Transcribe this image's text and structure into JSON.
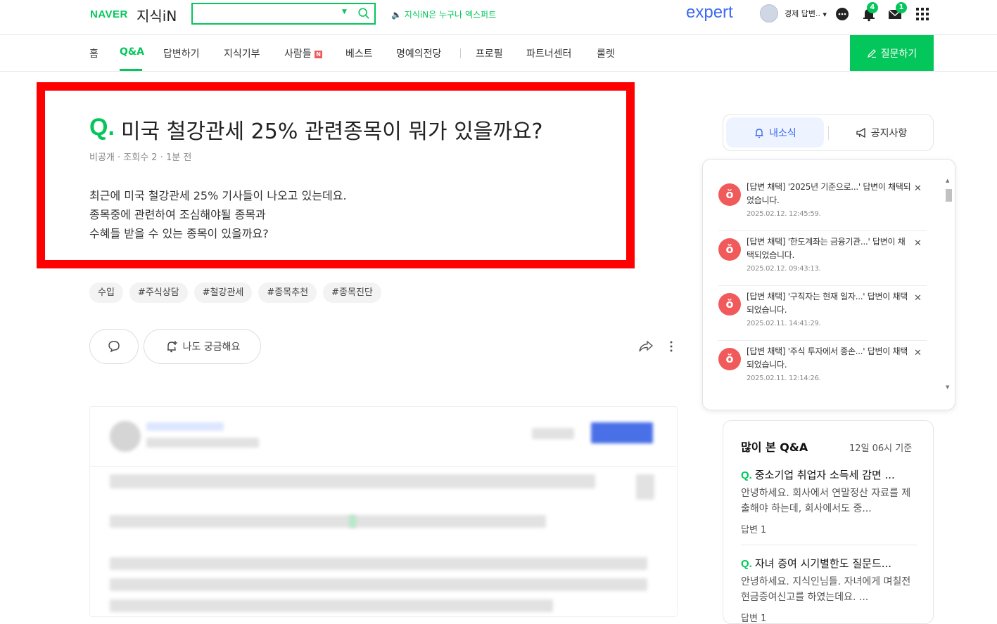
{
  "header": {
    "naver_logo": "NAVER",
    "kin_logo": "지식iN",
    "search_placeholder": "",
    "promo": "지식iN은 누구나 엑스퍼트",
    "expert_logo": "expert",
    "username": "경제 답변..",
    "notification_count": "4",
    "mail_count": "1"
  },
  "nav": {
    "items": [
      "홈",
      "Q&A",
      "답변하기",
      "지식기부",
      "사람들",
      "베스트",
      "명예의전당",
      "프로필",
      "파트너센터",
      "룰렛"
    ],
    "active": "Q&A",
    "new_badge": "N",
    "ask_button": "질문하기"
  },
  "question": {
    "q_mark": "Q.",
    "title": "미국 철강관세 25% 관련종목이 뭐가 있을까요?",
    "meta": "비공개 · 조회수 2 · 1분 전",
    "body": [
      "최근에 미국 철강관세 25% 기사들이 나오고 있는데요.",
      "종목중에 관련하여 조심해야될 종목과",
      "수혜들 받을 수 있는 종목이 있을까요?"
    ],
    "tags": [
      "수입",
      "#주식상담",
      "#철강관세",
      "#종목추천",
      "#종목진단"
    ],
    "curious_button": "나도 궁금해요"
  },
  "side_tabs": {
    "my_news": "내소식",
    "notice": "공지사항"
  },
  "notifications": [
    {
      "text": "[답변 채택] '2025년 기준으로...' 답변이 채택되었습니다.",
      "time": "2025.02.12. 12:45:59."
    },
    {
      "text": "[답변 채택] '한도계좌는 금융기관...' 답변이 채택되었습니다.",
      "time": "2025.02.12. 09:43:13."
    },
    {
      "text": "[답변 채택] '구직자는 현재 일자...' 답변이 채택되었습니다.",
      "time": "2025.02.11. 14:41:29."
    },
    {
      "text": "[답변 채택] '주식 투자에서 종손...' 답변이 채택되었습니다.",
      "time": "2025.02.11. 12:14:26."
    }
  ],
  "popular": {
    "title": "많이 본 Q&A",
    "date": "12일 06시 기준",
    "items": [
      {
        "q": "중소기업 취업자 소득세 감면 ...",
        "body": "안녕하세요. 회사에서 연말정산 자료를 제출해야 하는데, 회사에서도 중...",
        "answers": "답변 1"
      },
      {
        "q": "자녀 증여 시기별한도 질문드...",
        "body": "안녕하세요. 지식인님들. 자녀에게 며칠전 현금증여신고를 하였는데요. ...",
        "answers": "답변 1"
      }
    ]
  }
}
